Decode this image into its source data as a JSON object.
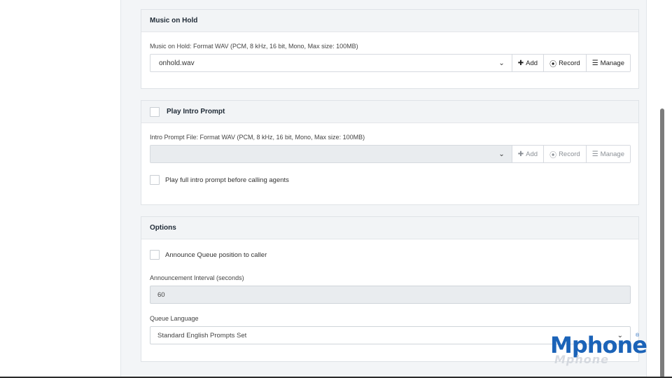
{
  "music_on_hold": {
    "title": "Music on Hold",
    "file_label": "Music on Hold: Format WAV (PCM, 8 kHz, 16 bit, Mono, Max size: 100MB)",
    "selected_file": "onhold.wav",
    "add_label": "Add",
    "record_label": "Record",
    "manage_label": "Manage"
  },
  "intro_prompt": {
    "title": "Play Intro Prompt",
    "file_label": "Intro Prompt File: Format WAV (PCM, 8 kHz, 16 bit, Mono, Max size: 100MB)",
    "selected_file": "",
    "add_label": "Add",
    "record_label": "Record",
    "manage_label": "Manage",
    "full_prompt_label": "Play full intro prompt before calling agents"
  },
  "options": {
    "title": "Options",
    "announce_label": "Announce Queue position to caller",
    "interval_label": "Announcement Interval (seconds)",
    "interval_value": "60",
    "language_label": "Queue Language",
    "language_value": "Standard English Prompts Set"
  },
  "logo": {
    "text": "Mphone",
    "reg": "®"
  },
  "icons": {
    "add": "plus-icon",
    "record": "record-icon",
    "manage": "list-icon",
    "dropdown": "chevron-down-icon"
  },
  "colors": {
    "brand": "#1b63b8",
    "card_header": "#f2f4f6",
    "disabled": "#e9ecef"
  }
}
